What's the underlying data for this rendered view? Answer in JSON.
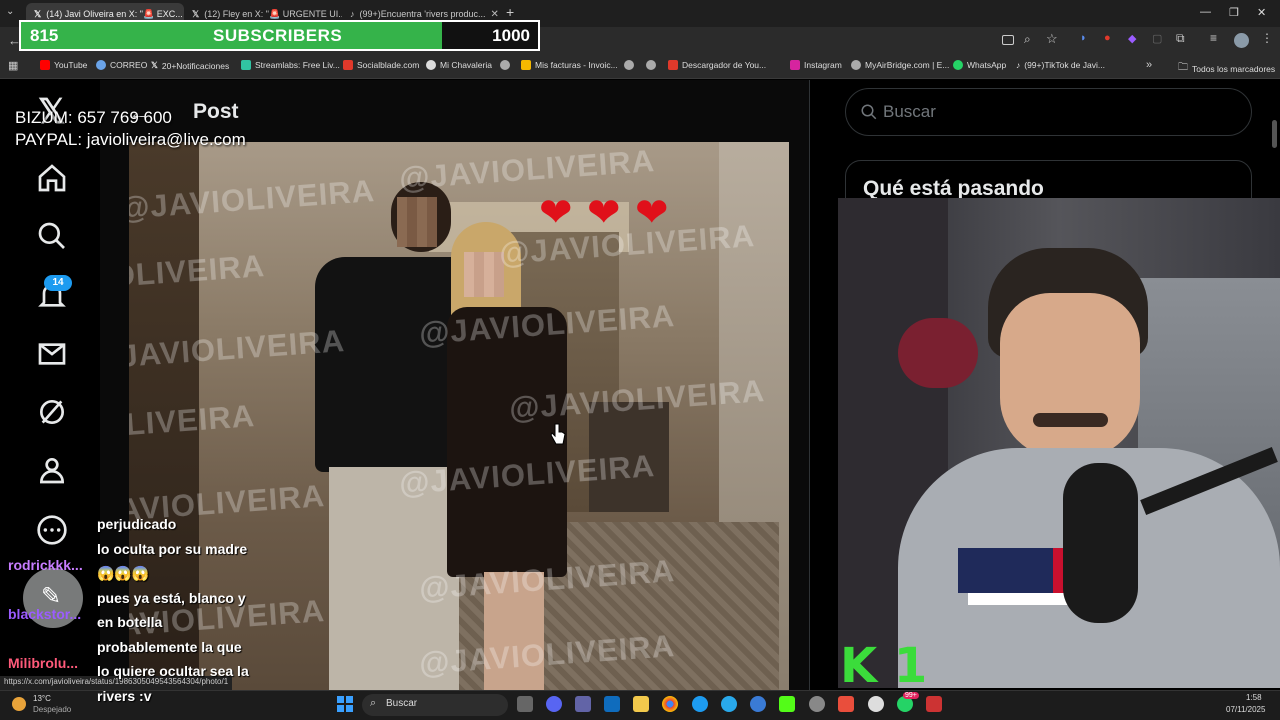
{
  "browser": {
    "tabs": [
      {
        "label": "(14) Javi Oliveira en X: \"🚨 EXC...",
        "active": true
      },
      {
        "label": "(12) Fley en X: \"🚨 URGENTE UI...",
        "active": false
      },
      {
        "label": "(99+)Encuentra 'rivers produc...",
        "active": false
      }
    ],
    "new_tab": "+",
    "bookmarks": [
      {
        "label": "YouTube",
        "color": "#ff0000"
      },
      {
        "label": "CORREO",
        "color": "#6aa3e8"
      },
      {
        "label": "20+Notificaciones",
        "color": "#ffffff"
      },
      {
        "label": "Streamlabs: Free Liv...",
        "color": "#31c3a2"
      },
      {
        "label": "Socialblade.com",
        "color": "#e0392b"
      },
      {
        "label": "Mi Chavaleria",
        "color": "#dddddd"
      },
      {
        "label": "",
        "color": "#aaaaaa"
      },
      {
        "label": "Mis facturas - Invoic...",
        "color": "#f5b800"
      },
      {
        "label": "",
        "color": "#aaaaaa"
      },
      {
        "label": "",
        "color": "#aaaaaa"
      },
      {
        "label": "Descargador de You...",
        "color": "#e0392b"
      },
      {
        "label": "Instagram",
        "color": "#d6249f"
      },
      {
        "label": "MyAirBridge.com | E...",
        "color": "#aaaaaa"
      },
      {
        "label": "WhatsApp",
        "color": "#25d366"
      },
      {
        "label": "(99+)TikTok de Javi...",
        "color": "#ffffff"
      }
    ],
    "bookmarks_more": "»",
    "all_bookmarks": "Todos los marcadores",
    "status_url": "https://x.com/javioliveira/status/1986305049543564304/photo/1"
  },
  "overlay": {
    "subscribers_current": "815",
    "subscribers_label": "SUBSCRIBERS",
    "subscribers_goal": "1000",
    "progress_fraction": 0.815,
    "bizum": "BIZUM: 657 769 600",
    "paypal": "PAYPAL: javioliveira@live.com",
    "cam_logo": "K 1"
  },
  "x": {
    "post_title": "Post",
    "notification_count": "14",
    "search_placeholder": "Buscar",
    "trending_title": "Qué está pasando",
    "watermark": "@JAVIOLIVEIRA"
  },
  "chat": [
    {
      "user": "",
      "message": "perjudicado",
      "color": "#ffffff"
    },
    {
      "user": "rodrickkk...",
      "message": "lo oculta por su madre",
      "color": "#c77dff"
    },
    {
      "user": "",
      "message": "😱😱😱",
      "color": "#ffffff"
    },
    {
      "user": "blackstor...",
      "message": "pues ya está, blanco y",
      "color": "#9b5cff"
    },
    {
      "user": "",
      "message": "en botella",
      "color": "#ffffff"
    },
    {
      "user": "Milibrolu...",
      "message": "probablemente la que",
      "color": "#ff5a7a"
    },
    {
      "user": "",
      "message": "lo quiere ocultar sea la",
      "color": "#ffffff"
    },
    {
      "user": "",
      "message": "rivers :v",
      "color": "#ffffff"
    }
  ],
  "taskbar": {
    "weather_temp": "13°C",
    "weather_desc": "Despejado",
    "search": "Buscar",
    "time": "1:58",
    "date": "07/11/2025",
    "notif_badge": "99+"
  }
}
